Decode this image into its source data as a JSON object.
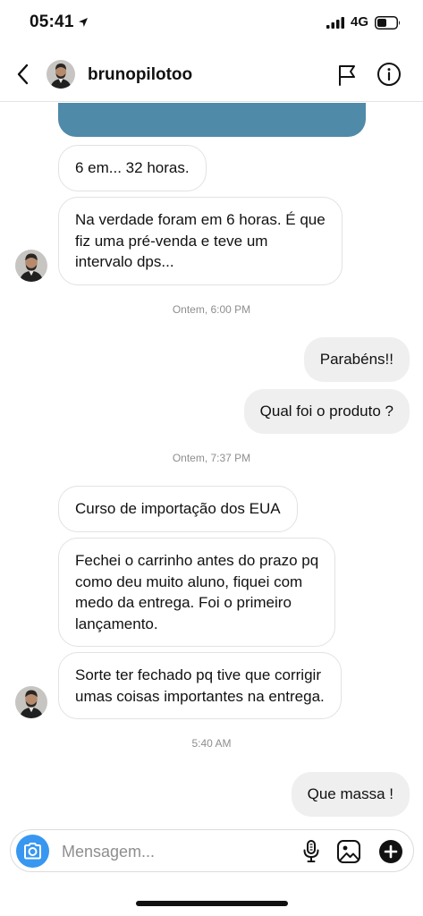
{
  "status_bar": {
    "time": "05:41",
    "network": "4G"
  },
  "header": {
    "username": "brunopilotoo"
  },
  "messages": [
    {
      "type": "text",
      "direction": "in",
      "text": "6 em... 32 horas."
    },
    {
      "type": "text",
      "direction": "in",
      "text": "Na verdade foram em 6 horas. É que\nfiz uma pré-venda e teve um\nintervalo dps..."
    },
    {
      "type": "timestamp",
      "text": "Ontem, 6:00 PM"
    },
    {
      "type": "text",
      "direction": "out",
      "text": "Parabéns!!"
    },
    {
      "type": "text",
      "direction": "out",
      "text": "Qual foi o produto ?"
    },
    {
      "type": "timestamp",
      "text": "Ontem, 7:37 PM"
    },
    {
      "type": "text",
      "direction": "in",
      "text": "Curso de importação dos EUA"
    },
    {
      "type": "text",
      "direction": "in",
      "text": "Fechei o carrinho antes do prazo pq\ncomo deu muito aluno, fiquei com\nmedo da entrega. Foi o primeiro\nlançamento."
    },
    {
      "type": "text",
      "direction": "in",
      "text": "Sorte ter fechado pq tive que corrigir\numas coisas importantes na entrega."
    },
    {
      "type": "timestamp",
      "text": "5:40 AM"
    },
    {
      "type": "text",
      "direction": "out",
      "text": "Que massa !"
    }
  ],
  "composer": {
    "placeholder": "Mensagem..."
  },
  "colors": {
    "accent": "#3897f0",
    "media_card": "#4f8aa8",
    "bubble_out": "#efefef",
    "timestamp": "#8e8e8e"
  },
  "icons": [
    "back-icon",
    "flag-icon",
    "info-icon",
    "camera-icon",
    "mic-icon",
    "gallery-icon",
    "plus-icon"
  ]
}
